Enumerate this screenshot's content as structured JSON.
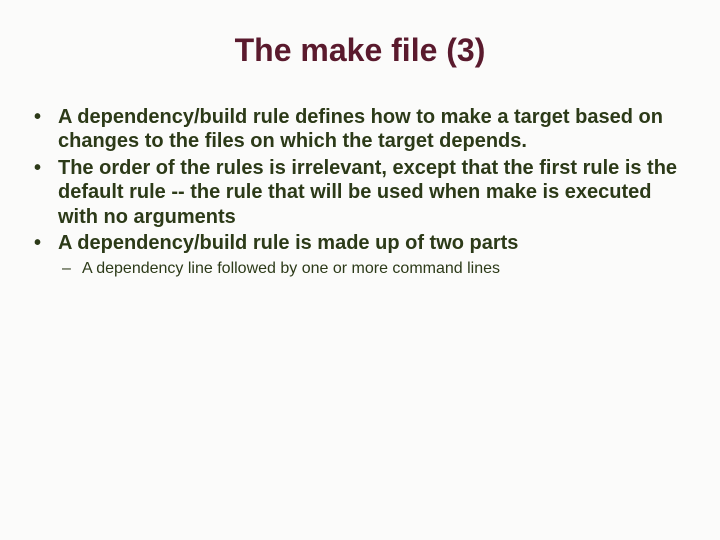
{
  "slide": {
    "title": "The make file (3)",
    "bullets": [
      "A dependency/build rule defines how to make a target based on changes to the files on which the target depends.",
      "The order of the rules is irrelevant, except that the first rule is the default rule -- the rule that will be used when make is executed with no arguments",
      "A dependency/build rule is made up of two parts"
    ],
    "subbullets_of_last": [
      "A dependency line followed by one or more command lines"
    ]
  }
}
